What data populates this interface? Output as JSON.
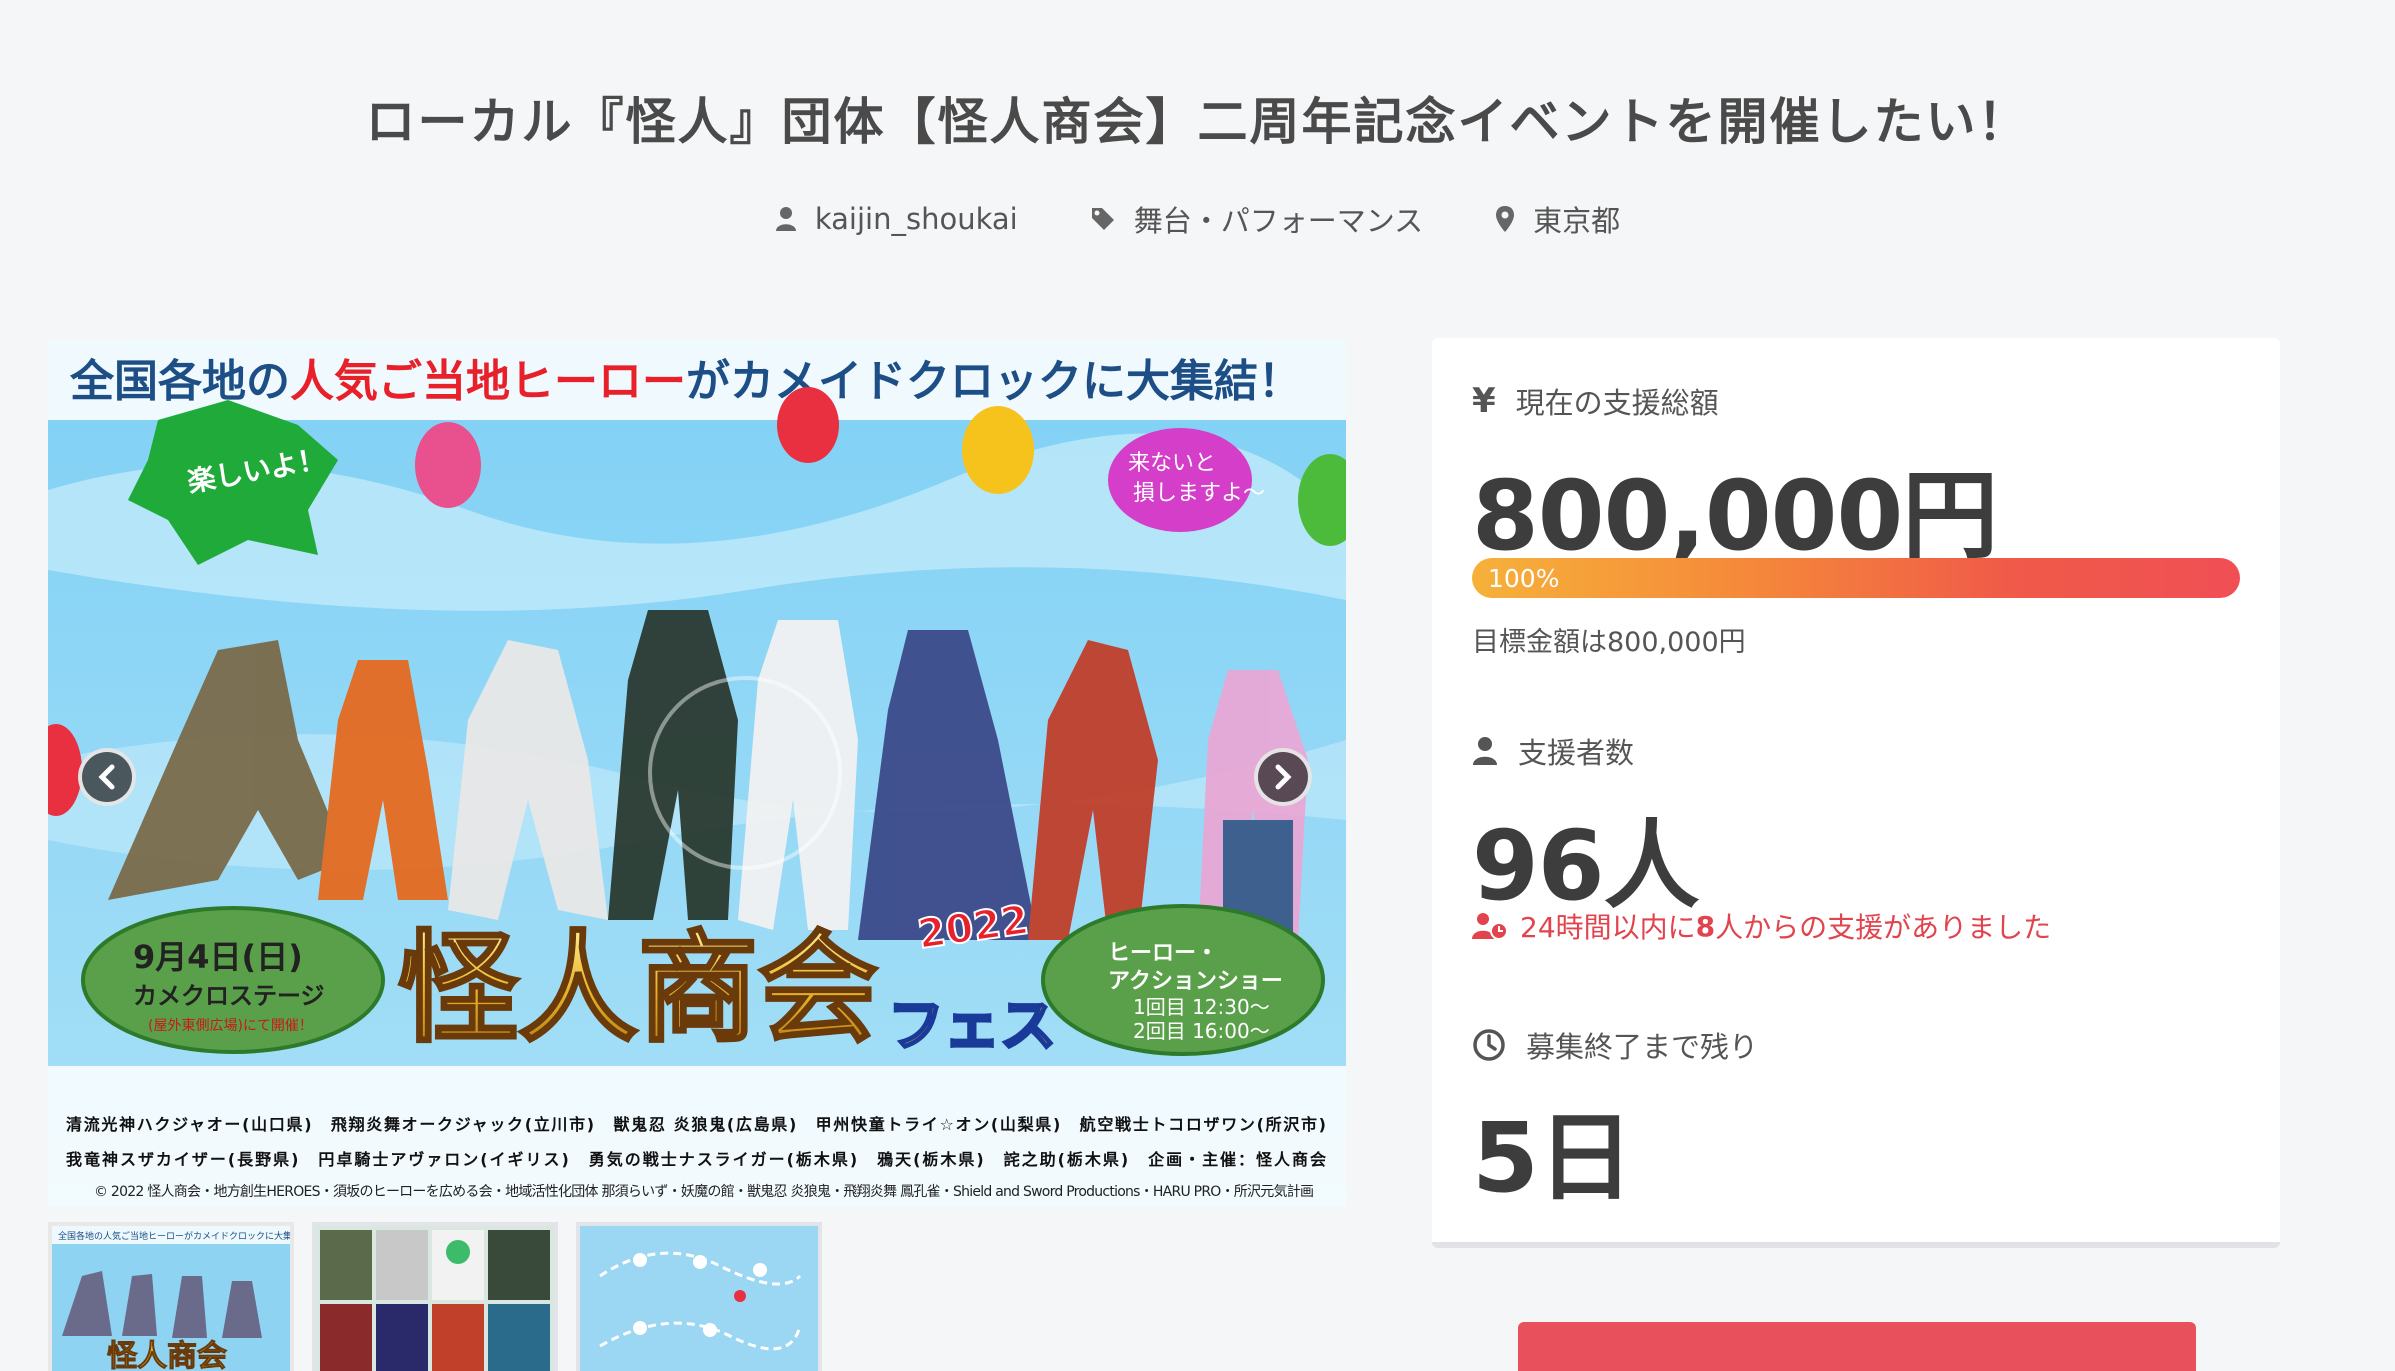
{
  "project": {
    "title": "ローカル『怪人』団体【怪人商会】二周年記念イベントを開催したい！",
    "owner": "kaijin_shoukai",
    "category": "舞台・パフォーマンス",
    "location": "東京都"
  },
  "carousel": {
    "banner_headline_left": "全国各地の",
    "banner_headline_red": "人気ご当地ヒーロー",
    "banner_headline_right": "がカメイドクロックに大集結！",
    "bubble_left": "楽しいよ！",
    "bubble_right_1": "来ないと",
    "bubble_right_2": "損しますよ〜",
    "event_logo": "怪人商会",
    "event_logo_sub": "フェス",
    "event_year": "2022",
    "date_line": "9月4日(日)",
    "venue_line": "カメクロステージ",
    "venue_note": "(屋外東側広場)にて開催！",
    "show_title_1": "ヒーロー・",
    "show_title_2": "アクションショー",
    "show_time_1": "1回目 12:30〜",
    "show_time_2": "2回目 16:00〜",
    "heroes_row1": "清流光神ハクジャオー(山口県)　飛翔炎舞オークジャック(立川市)　獣鬼忍 炎狼鬼(広島県)　甲州快童トライ☆オン(山梨県)　航空戦士トコロザワン(所沢市)",
    "heroes_row2": "我竜神スザカイザー(長野県)　円卓騎士アヴァロン(イギリス)　勇気の戦士ナスライガー(栃木県)　鴉天(栃木県)　詫之助(栃木県)　企画・主催：怪人商会",
    "copyright": "© 2022 怪人商会・地方創生HEROES・須坂のヒーローを広める会・地域活性化団体 那須らいず・妖魔の館・獣鬼忍 炎狼鬼・飛翔炎舞 鳳孔雀・Shield and Sword Productions・HARU PRO・所沢元気計画",
    "thumb1_caption": "全国各地の人気ご当地ヒーローがカメイドクロックに大集結！"
  },
  "stats": {
    "amount_label": "現在の支援総額",
    "amount_value": "800,000円",
    "progress_percent": 100,
    "progress_label": "100%",
    "goal_text": "目標金額は800,000円",
    "backers_label": "支援者数",
    "backers_value": "96人",
    "recent_prefix": "24時間以内に",
    "recent_count": "8",
    "recent_suffix": "人からの支援がありました",
    "remaining_label": "募集終了まで残り",
    "remaining_value": "5日"
  },
  "colors": {
    "accent_red": "#e8505b",
    "progress_start": "#f6b13a",
    "progress_end": "#f04f55"
  }
}
